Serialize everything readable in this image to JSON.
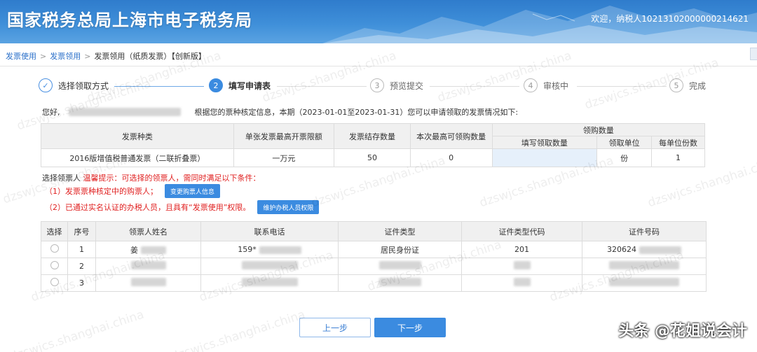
{
  "header": {
    "title": "国家税务总局上海市电子税务局",
    "welcome": "欢迎，纳税人10213102000000214621"
  },
  "breadcrumb": {
    "items": [
      "发票使用",
      "发票领用",
      "发票领用（纸质发票）【创新版】"
    ]
  },
  "steps": [
    {
      "num": "✓",
      "label": "选择领取方式"
    },
    {
      "num": "2",
      "label": "填写申请表"
    },
    {
      "num": "3",
      "label": "预览提交"
    },
    {
      "num": "4",
      "label": "审核中"
    },
    {
      "num": "5",
      "label": "完成"
    }
  ],
  "info": {
    "prefix": "您好,",
    "text": "根据您的票种核定信息，本期（2023-01-01至2023-01-31）您可以申请领取的发票情况如下:"
  },
  "invoice_table": {
    "headers": {
      "type": "发票种类",
      "max_amount": "单张发票最高开票限额",
      "stock": "发票结存数量",
      "max_qty": "本次最高可领购数量",
      "group": "领购数量",
      "fill_qty": "填写领取数量",
      "unit": "领取单位",
      "per_unit": "每单位份数"
    },
    "row": {
      "type": "2016版增值税普通发票（二联折叠票）",
      "max_amount": "一万元",
      "stock": "50",
      "max_qty": "0",
      "fill_qty": "",
      "unit": "份",
      "per_unit": "1"
    }
  },
  "tips": {
    "label": "选择领票人",
    "warning": "温馨提示：可选择的领票人，需同时满足以下条件：",
    "cond1": "（1）发票票种核定中的购票人；",
    "cond1_button": "变更购票人信息",
    "cond2": "（2）已通过实名认证的办税人员，且具有“发票使用”权限。",
    "cond2_button": "维护办税人员权限"
  },
  "person_table": {
    "headers": [
      "选择",
      "序号",
      "领票人姓名",
      "联系电话",
      "证件类型",
      "证件类型代码",
      "证件号码"
    ],
    "rows": [
      {
        "seq": "1",
        "name": "姜",
        "phone": "159*",
        "id_type": "居民身份证",
        "id_code": "201",
        "id_no": "320624"
      },
      {
        "seq": "2",
        "name": "",
        "phone": "",
        "id_type": "",
        "id_code": "",
        "id_no": ""
      },
      {
        "seq": "3",
        "name": "",
        "phone": "",
        "id_type": "",
        "id_code": "",
        "id_no": ""
      }
    ]
  },
  "buttons": {
    "prev": "上一步",
    "next": "下一步"
  },
  "watermark": "dzswjcs.shanghai.china",
  "credit": "头条 @花姐说会计",
  "colors": {
    "primary": "#3b8be0",
    "warning": "#e02020",
    "header": "#3f8fd9"
  }
}
